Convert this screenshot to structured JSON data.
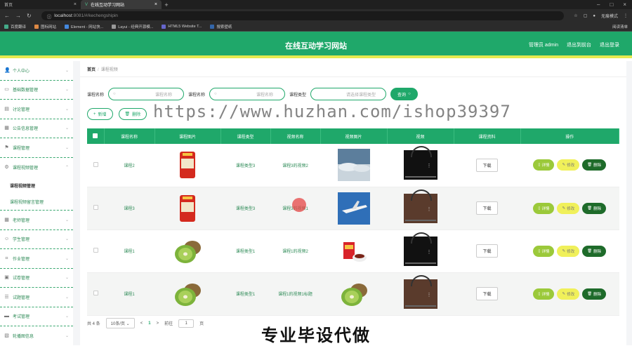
{
  "browser": {
    "tabs": [
      {
        "label": "首页"
      },
      {
        "label": "在线互动学习网站"
      }
    ],
    "new_tab": "+",
    "url_host": "localhost",
    "url_rest": ":8081/#/kechengshipin",
    "profile": "无痕模式",
    "bookmarks": [
      "百度翻译",
      "图标网站",
      "Element - 网站快...",
      "Layui - 经典开源模...",
      "HTML5 Website T...",
      "搜索壁纸"
    ],
    "bookmarks_right": "阅读清单"
  },
  "header": {
    "title": "在线互动学习网站",
    "admin": "管理员 admin",
    "back_home": "退出到前台",
    "logout": "退出登录"
  },
  "sidebar": {
    "items": [
      {
        "label": "个人中心",
        "icon": "user-icon"
      },
      {
        "label": "基础数据管理",
        "icon": "folder-icon"
      },
      {
        "label": "讨论管理",
        "icon": "document-icon"
      },
      {
        "label": "公告信息管理",
        "icon": "calendar-icon"
      },
      {
        "label": "课程管理",
        "icon": "flag-icon"
      },
      {
        "label": "课程视频管理",
        "icon": "gear-icon"
      }
    ],
    "subitems": [
      "课程视频管理",
      "课程视频留言管理"
    ],
    "items2": [
      {
        "label": "老师管理",
        "icon": "grid-icon"
      },
      {
        "label": "学生管理",
        "icon": "person-icon"
      },
      {
        "label": "作业管理",
        "icon": "crop-icon"
      },
      {
        "label": "试卷管理",
        "icon": "exam-icon"
      },
      {
        "label": "试题管理",
        "icon": "list-icon"
      },
      {
        "label": "考试管理",
        "icon": "monitor-icon"
      },
      {
        "label": "轮播图信息",
        "icon": "image-icon"
      }
    ]
  },
  "breadcrumb": {
    "home": "首页",
    "sep": "/",
    "current": "课程视频"
  },
  "search": {
    "name_label": "课程名称",
    "name_placeholder": "课程名称",
    "video_label": "课程名称",
    "video_placeholder": "课程名称",
    "type_label": "课程类型",
    "type_placeholder": "请选择课程类型",
    "query_btn": "查询"
  },
  "actions": {
    "add": "新增",
    "delete": "删除"
  },
  "table": {
    "headers": [
      "课程名称",
      "课程图片",
      "课程类型",
      "视频名称",
      "视频图片",
      "视频",
      "课程资料",
      "操作"
    ],
    "rows": [
      {
        "course": "课程2",
        "type": "课程类型3",
        "video_name": "课程3的视频2",
        "download": "下载",
        "thumb": "rice",
        "vthumb": "clouds",
        "video": "dark"
      },
      {
        "course": "课程3",
        "type": "课程类型3",
        "video_name": "课程3的视频1",
        "download": "下载",
        "thumb": "rice",
        "vthumb": "plane",
        "video": "room"
      },
      {
        "course": "课程1",
        "type": "课程类型1",
        "video_name": "课程1的视频2",
        "download": "下载",
        "thumb": "kiwi",
        "vthumb": "gift",
        "video": "dark"
      },
      {
        "course": "课程1",
        "type": "课程类型1",
        "video_name": "课程1的视频1标题",
        "download": "下载",
        "thumb": "kiwi",
        "vthumb": "kiwi",
        "video": "room"
      }
    ],
    "ops": {
      "detail": "详情",
      "edit": "修改",
      "delete": "删除"
    }
  },
  "pager": {
    "total": "共 4 条",
    "size": "10条/页",
    "prev": "<",
    "page": "1",
    "next": ">",
    "goto": "前往",
    "goto_val": "1",
    "unit": "页"
  },
  "overlay": {
    "watermark": "https://www.huzhan.com/ishop39397",
    "caption": "专业毕设代做"
  },
  "colors": {
    "primary": "#1fa86a",
    "accent": "#e5ea4f",
    "danger": "#1e6b2a"
  }
}
